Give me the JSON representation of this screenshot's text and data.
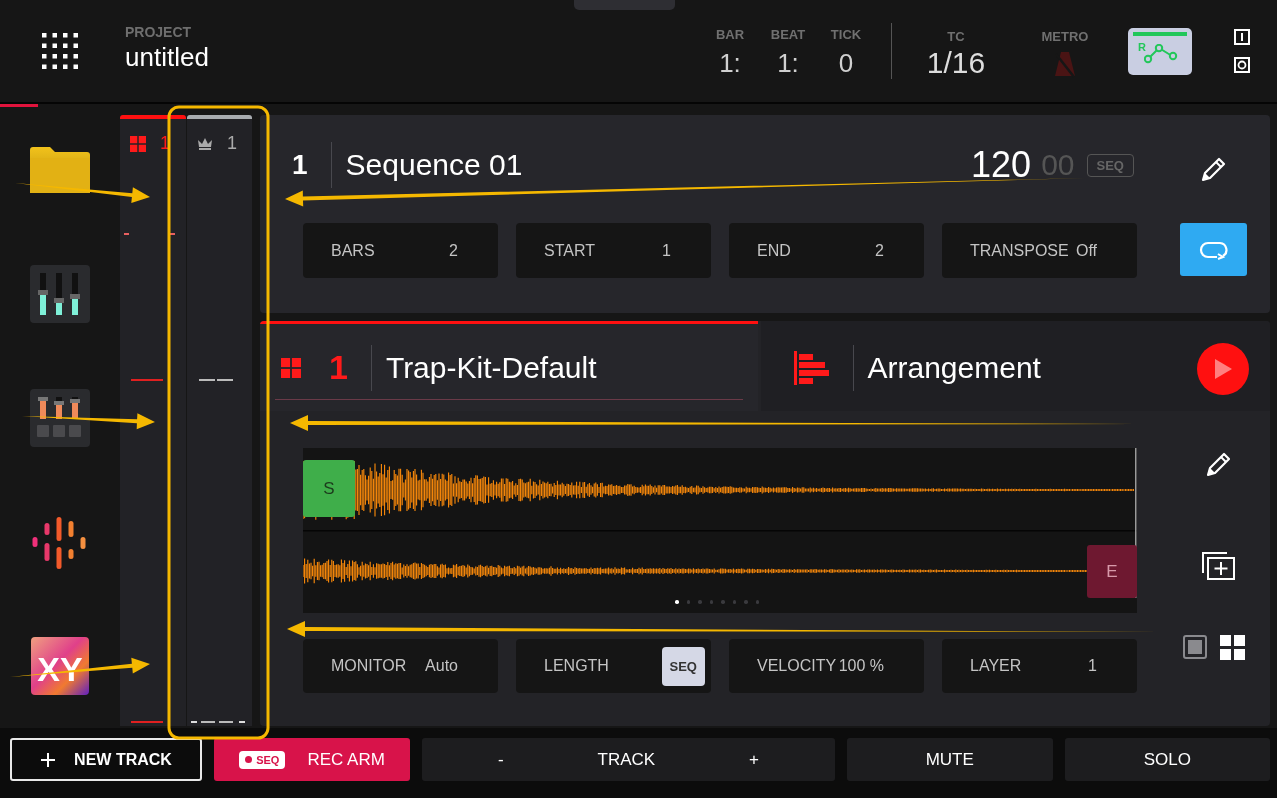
{
  "header": {
    "project_label": "PROJECT",
    "project_name": "untitled",
    "counters": [
      {
        "label": "BAR",
        "value": "1:"
      },
      {
        "label": "BEAT",
        "value": "1:"
      },
      {
        "label": "TICK",
        "value": "0"
      }
    ],
    "tc": {
      "label": "TC",
      "value": "1/16"
    },
    "metro": {
      "label": "METRO",
      "on": false
    },
    "automation": {
      "label": "R"
    }
  },
  "sidebar": {
    "xy_label": "XY"
  },
  "strips": [
    {
      "kind": "program",
      "number": "1",
      "selected": true
    },
    {
      "kind": "master",
      "number": "1",
      "selected": false
    }
  ],
  "sequence": {
    "number": "1",
    "name": "Sequence 01",
    "bpm": "120",
    "bpm_fraction": "00",
    "tempo_source": "SEQ",
    "fields": [
      {
        "label": "BARS",
        "value": "2"
      },
      {
        "label": "START",
        "value": "1"
      },
      {
        "label": "END",
        "value": "2"
      },
      {
        "label": "TRANSPOSE",
        "value": "Off"
      }
    ],
    "loop": true
  },
  "track": {
    "tabs": [
      {
        "kind": "program",
        "number": "1",
        "label": "Trap-Kit-Default",
        "selected": true
      },
      {
        "kind": "arrangement",
        "label": "Arrangement",
        "selected": false
      }
    ],
    "markers": [
      {
        "kind": "start",
        "label": "S"
      },
      {
        "kind": "end",
        "label": "E"
      }
    ],
    "page_dots": [
      {
        "selected": true
      },
      {
        "selected": false
      },
      {
        "selected": false
      },
      {
        "selected": false
      },
      {
        "selected": false
      },
      {
        "selected": false
      },
      {
        "selected": false
      },
      {
        "selected": false
      }
    ],
    "fields": [
      {
        "kind": "value",
        "label": "MONITOR",
        "value": "Auto"
      },
      {
        "kind": "button",
        "label": "LENGTH",
        "value": "SEQ"
      },
      {
        "kind": "value",
        "label": "VELOCITY",
        "value": "100 %"
      },
      {
        "kind": "value",
        "label": "LAYER",
        "value": "1"
      }
    ],
    "views": [
      {
        "kind": "single",
        "selected": false
      },
      {
        "kind": "grid",
        "selected": true
      }
    ]
  },
  "footer": {
    "buttons": [
      {
        "kind": "new",
        "label": "NEW TRACK"
      },
      {
        "kind": "rec",
        "badge": "SEQ",
        "label": "REC ARM"
      },
      {
        "kind": "stepper",
        "minus": "-",
        "label": "TRACK",
        "plus": "+"
      },
      {
        "kind": "plain",
        "label": "MUTE"
      },
      {
        "kind": "plain",
        "label": "SOLO"
      }
    ]
  }
}
